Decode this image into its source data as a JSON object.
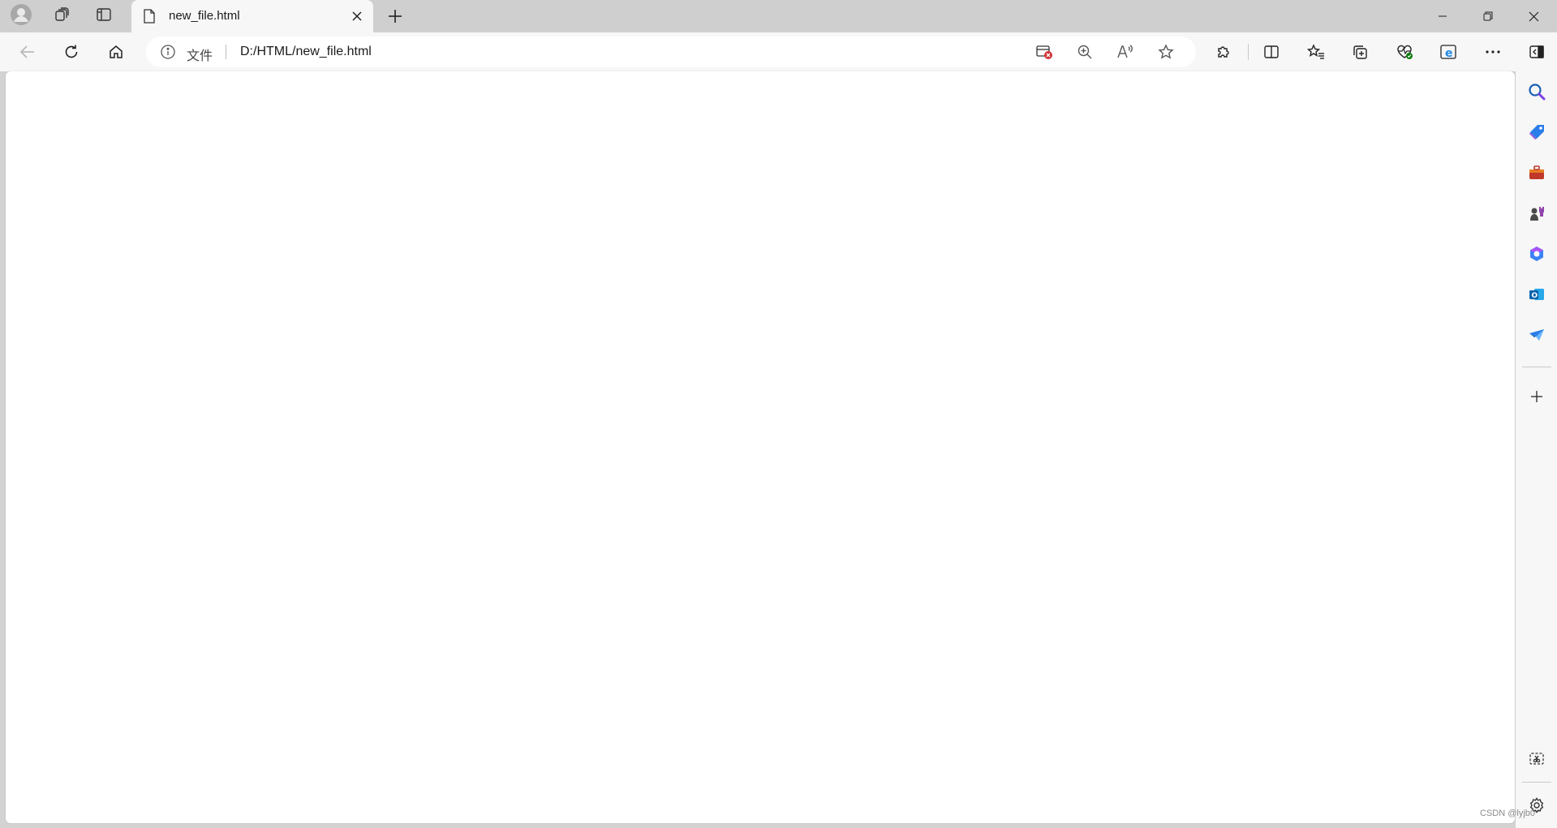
{
  "tab": {
    "title": "new_file.html"
  },
  "address_bar": {
    "scheme_label": "文件",
    "url": "D:/HTML/new_file.html"
  },
  "icons": {
    "profile": "profile-avatar-icon",
    "workspaces": "workspaces-icon",
    "vertical_tabs": "vertical-tabs-icon",
    "page": "page-icon",
    "close_tab": "close-icon",
    "new_tab": "plus-icon",
    "back": "back-arrow-icon",
    "refresh": "refresh-icon",
    "home": "home-icon",
    "site_info": "info-icon",
    "blocked": "popup-blocked-icon",
    "zoom": "zoom-in-icon",
    "read_aloud": "read-aloud-icon",
    "favorite": "star-icon",
    "extensions": "extensions-icon",
    "split_screen": "split-screen-icon",
    "favorites": "favorites-icon",
    "collections": "collections-icon",
    "performance": "performance-icon",
    "ie_mode": "ie-mode-icon",
    "more": "more-icon",
    "sidebar_toggle": "sidebar-toggle-icon"
  },
  "sidebar": {
    "items": [
      "search-icon",
      "shopping-icon",
      "tools-icon",
      "games-icon",
      "office-icon",
      "outlook-icon",
      "drop-icon",
      "add-icon"
    ],
    "bottom": [
      "screenshot-icon",
      "settings-icon"
    ]
  },
  "colors": {
    "accent_blue": "#0c59a4",
    "red_badge": "#d13438",
    "green_badge": "#107c10"
  },
  "watermark": "CSDN @lyjb0"
}
